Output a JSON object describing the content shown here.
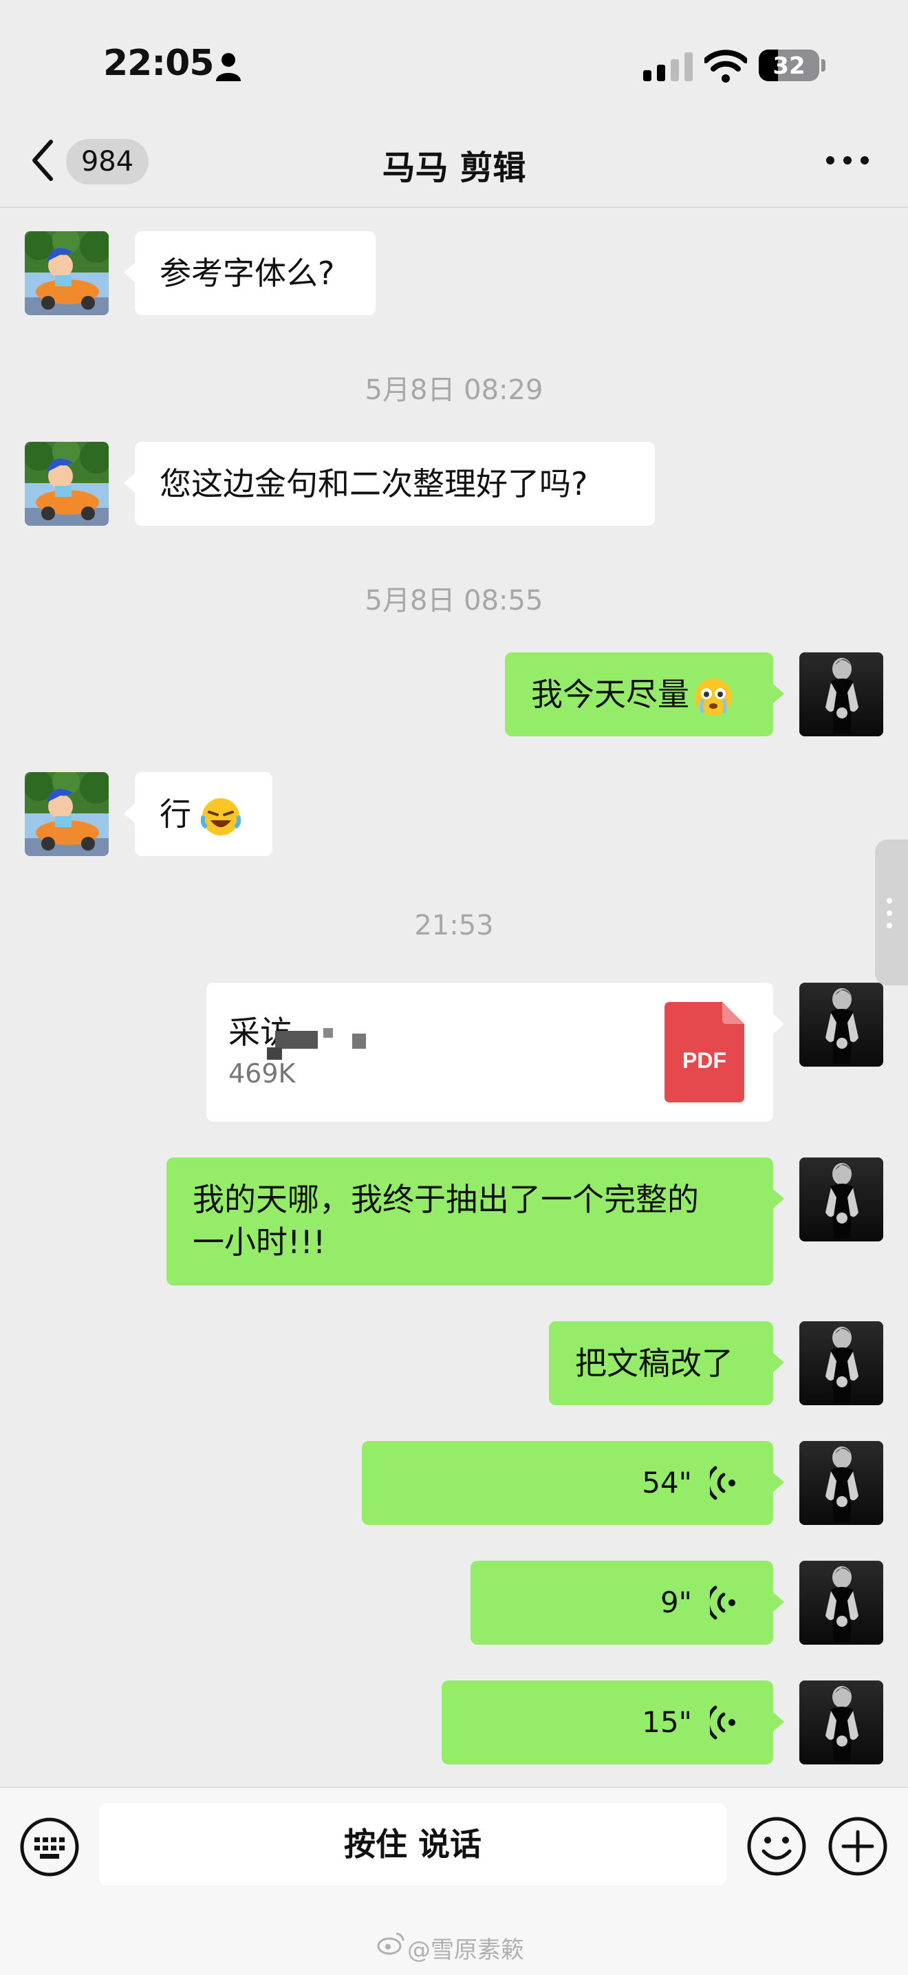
{
  "status_bar": {
    "time": "22:05",
    "battery": "32",
    "battery_level": 0.32
  },
  "nav": {
    "unread_count": "984",
    "title": "马马 剪辑"
  },
  "messages": {
    "m1": "参考字体么?",
    "ts1": "5月8日 08:29",
    "m2": "您这边金句和二次整理好了吗?",
    "ts2": "5月8日 08:55",
    "m3": "我今天尽量",
    "m4": "行",
    "ts3": "21:53",
    "file": {
      "name": "采访",
      "size": "469K",
      "type_label": "PDF"
    },
    "m5_line1": "我的天哪，我终于抽出了一个完整的",
    "m5_line2": "一小时!!!",
    "m6": "把文稿改了",
    "voice1": "54\"",
    "voice2": "9\"",
    "voice3": "15\""
  },
  "input_bar": {
    "hold_to_talk": "按住 说话"
  },
  "watermark": "@雪原素簌",
  "icons": {
    "back": "chevron-left-icon",
    "more": "ellipsis-icon",
    "keyboard": "keyboard-icon",
    "emoji": "smiley-icon",
    "plus": "plus-icon",
    "voice": "voice-wave-icon",
    "pdf": "pdf-file-icon"
  },
  "colors": {
    "out_bubble": "#95ec69",
    "in_bubble": "#ffffff",
    "background": "#ededed",
    "pdf": "#e5484d"
  }
}
